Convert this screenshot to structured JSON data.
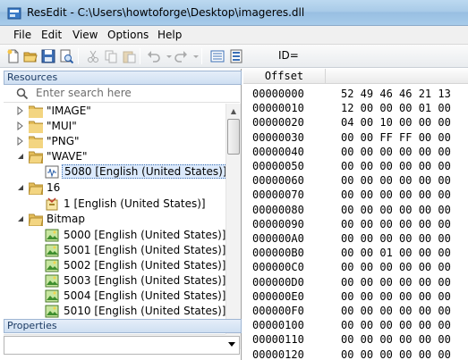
{
  "window": {
    "title": "ResEdit - C:\\Users\\howtoforge\\Desktop\\imageres.dll"
  },
  "menu": [
    "File",
    "Edit",
    "View",
    "Options",
    "Help"
  ],
  "toolbar": {
    "id_label": "ID="
  },
  "resources": {
    "header": "Resources",
    "search_placeholder": "Enter search here",
    "tree": [
      {
        "label": "\"IMAGE\"",
        "expanded": false
      },
      {
        "label": "\"MUI\"",
        "expanded": false
      },
      {
        "label": "\"PNG\"",
        "expanded": false
      },
      {
        "label": "\"WAVE\"",
        "expanded": true
      },
      {
        "label": "5080 [English (United States)]",
        "selected": true
      },
      {
        "label": "16",
        "expanded": true
      },
      {
        "label": "1 [English (United States)]"
      },
      {
        "label": "Bitmap",
        "expanded": true
      },
      {
        "label": "5000 [English (United States)]"
      },
      {
        "label": "5001 [English (United States)]"
      },
      {
        "label": "5002 [English (United States)]"
      },
      {
        "label": "5003 [English (United States)]"
      },
      {
        "label": "5004 [English (United States)]"
      },
      {
        "label": "5010 [English (United States)]"
      }
    ]
  },
  "properties": {
    "header": "Properties",
    "selected": ""
  },
  "hex": {
    "offset_header": "Offset",
    "rows": [
      {
        "offset": "00000000",
        "bytes": "52 49 46 46 21 13"
      },
      {
        "offset": "00000010",
        "bytes": "12 00 00 00 01 00"
      },
      {
        "offset": "00000020",
        "bytes": "04 00 10 00 00 00"
      },
      {
        "offset": "00000030",
        "bytes": "00 00 FF FF 00 00"
      },
      {
        "offset": "00000040",
        "bytes": "00 00 00 00 00 00"
      },
      {
        "offset": "00000050",
        "bytes": "00 00 00 00 00 00"
      },
      {
        "offset": "00000060",
        "bytes": "00 00 00 00 00 00"
      },
      {
        "offset": "00000070",
        "bytes": "00 00 00 00 00 00"
      },
      {
        "offset": "00000080",
        "bytes": "00 00 00 00 00 00"
      },
      {
        "offset": "00000090",
        "bytes": "00 00 00 00 00 00"
      },
      {
        "offset": "000000A0",
        "bytes": "00 00 00 00 00 00"
      },
      {
        "offset": "000000B0",
        "bytes": "00 00 01 00 00 00"
      },
      {
        "offset": "000000C0",
        "bytes": "00 00 00 00 00 00"
      },
      {
        "offset": "000000D0",
        "bytes": "00 00 00 00 00 00"
      },
      {
        "offset": "000000E0",
        "bytes": "00 00 00 00 00 00"
      },
      {
        "offset": "000000F0",
        "bytes": "00 00 00 00 00 00"
      },
      {
        "offset": "00000100",
        "bytes": "00 00 00 00 00 00"
      },
      {
        "offset": "00000110",
        "bytes": "00 00 00 00 00 00"
      },
      {
        "offset": "00000120",
        "bytes": "00 00 00 00 00 00"
      }
    ]
  }
}
